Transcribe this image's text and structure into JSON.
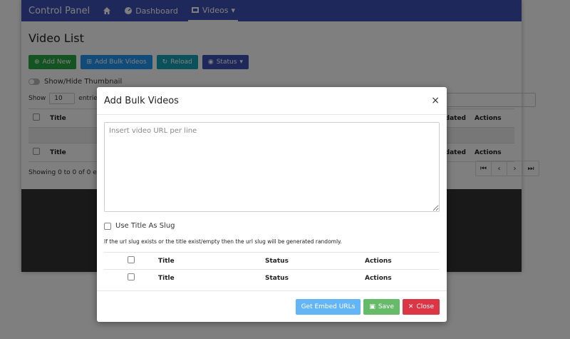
{
  "navbar": {
    "brand": "Control Panel",
    "items": [
      {
        "label": "Dashboard",
        "icon": "dashboard-icon"
      },
      {
        "label": "Videos",
        "icon": "video-icon"
      }
    ],
    "color": "#3f51b5"
  },
  "page": {
    "title": "Video List",
    "toolbar": {
      "add_new": "Add New",
      "add_bulk": "Add Bulk Videos",
      "reload": "Reload",
      "status": "Status"
    },
    "toggle_label": "Show/Hide Thumbnail",
    "show_label": "Show",
    "entries_value": "10",
    "entries_label": "entries",
    "table": {
      "headers": {
        "title": "Title",
        "updated": "Updated",
        "actions": "Actions"
      }
    },
    "info": "Showing 0 to 0 of 0 entri"
  },
  "modal": {
    "title": "Add Bulk Videos",
    "close_icon": "×",
    "textarea_placeholder": "Insert video URL per line",
    "slug_label": "Use Title As Slug",
    "slug_note": "If the url slug exists or the title exist/empty then the url slug will be generated randomly.",
    "table_headers": {
      "title": "Title",
      "status": "Status",
      "actions": "Actions"
    },
    "footer": {
      "embed": "Get Embed URLs",
      "save": "Save",
      "close": "Close"
    }
  },
  "colors": {
    "primary": "#3f51b5",
    "success": "#28a745",
    "danger": "#dc3545",
    "info": "#17a2b8"
  }
}
